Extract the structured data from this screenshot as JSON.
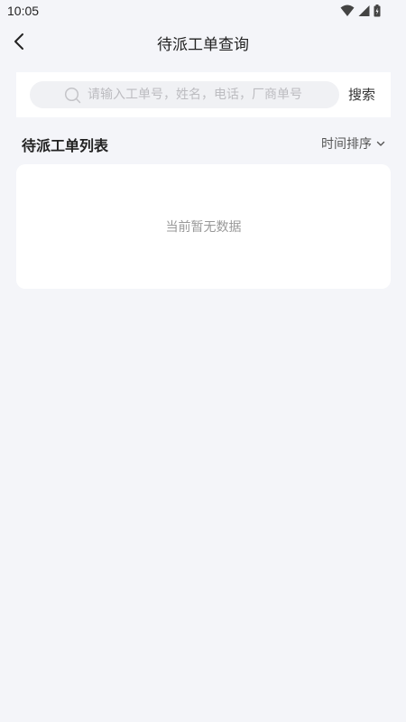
{
  "status_bar": {
    "time": "10:05",
    "icons": [
      "wifi-icon",
      "signal-icon",
      "battery-icon"
    ]
  },
  "header": {
    "title": "待派工单查询",
    "back_icon": "chevron-left-icon"
  },
  "search": {
    "placeholder": "请输入工单号，姓名，电话，厂商单号",
    "value": "",
    "button_label": "搜索",
    "icon": "search-icon"
  },
  "list": {
    "title": "待派工单列表",
    "sort_label": "时间排序",
    "sort_icon": "chevron-down-icon",
    "empty_text": "当前暂无数据",
    "items": []
  },
  "colors": {
    "page_background": "#f4f5f9",
    "card_background": "#ffffff",
    "search_background": "#f0f1f4",
    "placeholder_text": "#bcbcc0",
    "empty_text": "#999999"
  }
}
